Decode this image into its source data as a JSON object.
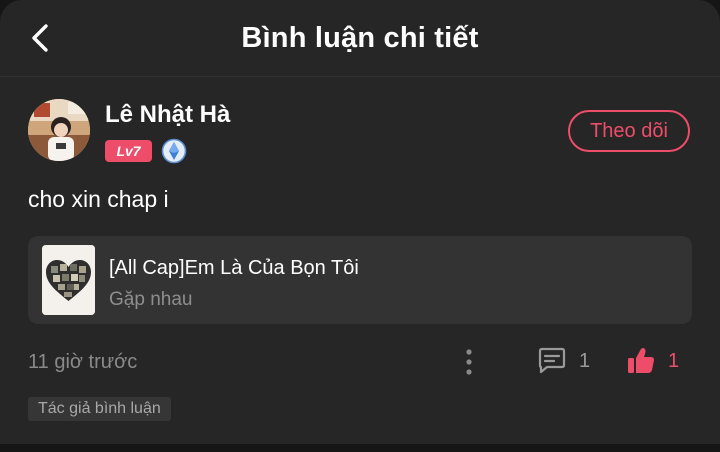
{
  "header": {
    "title": "Bình luận chi tiết",
    "back_icon": "chevron-left-icon"
  },
  "comment": {
    "user": {
      "name": "Lê Nhật Hà",
      "level": "Lv7",
      "verified_icon": "verified-badge-icon",
      "follow_label": "Theo dõi"
    },
    "text": "cho xin chap i",
    "story": {
      "title": "[All Cap]Em Là Của Bọn Tôi",
      "subtitle": "Gặp nhau"
    },
    "time": "11 giờ trước",
    "reply_count": "1",
    "like_count": "1",
    "author_tag": "Tác giả bình luận"
  },
  "colors": {
    "accent": "#ee4d6a",
    "background": "#262626",
    "card": "#333333",
    "muted_text": "#8a8a8a"
  },
  "icons": {
    "more": "more-vertical-icon",
    "reply": "comment-bubble-icon",
    "like": "thumbs-up-icon"
  }
}
